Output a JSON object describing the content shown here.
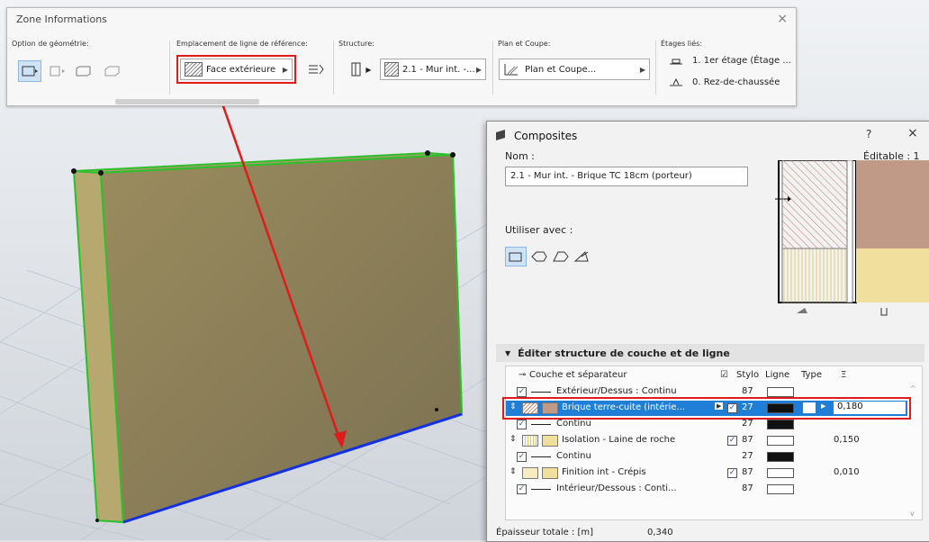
{
  "info": {
    "title": "Zone Informations",
    "groups": {
      "geometry": "Option de géométrie:",
      "refline": "Emplacement de ligne de référence:",
      "structure": "Structure:",
      "plan": "Plan et Coupe:",
      "levels": "Étages liés:"
    },
    "refline_value": "Face extérieure",
    "structure_value": "2.1 - Mur int. -...",
    "plan_value": "Plan et Coupe...",
    "level_top": "1. 1er étage (Étage ...",
    "level_bottom": "0. Rez-de-chaussée"
  },
  "dialog": {
    "title": "Composites",
    "help": "?",
    "close": "×",
    "name_label": "Nom :",
    "editable_label": "Éditable : 1",
    "name_value": "2.1 - Mur int. - Brique TC 18cm (porteur)",
    "use_with_label": "Utiliser avec :",
    "section_title": "Éditer structure de couche et de ligne",
    "columns": {
      "layer": "Couche et séparateur",
      "pen": "Stylo",
      "line": "Ligne",
      "type": "Type"
    },
    "rows": [
      {
        "kind": "sep",
        "label": "Extérieur/Dessus : Continu",
        "pen": "87"
      },
      {
        "kind": "layer",
        "label": "Brique terre-cuite (intérie...",
        "pen": "27",
        "thickness": "0,180",
        "selected": true
      },
      {
        "kind": "sep",
        "label": "Continu",
        "pen": "27"
      },
      {
        "kind": "layer",
        "label": "Isolation - Laine de roche",
        "pen": "87",
        "thickness": "0,150"
      },
      {
        "kind": "sep",
        "label": "Continu",
        "pen": "27"
      },
      {
        "kind": "layer",
        "label": "Finition int - Crépis",
        "pen": "87",
        "thickness": "0,010"
      },
      {
        "kind": "sep",
        "label": "Intérieur/Dessous : Conti...",
        "pen": "87"
      }
    ],
    "total_label": "Épaisseur totale : [m]",
    "total_value": "0,340"
  },
  "colors": {
    "highlight": "#e01b1b",
    "selection": "#1f7fd6",
    "wall": "#8e8158",
    "wall_edges": "#2dc02d",
    "ref_line": "#1530e0",
    "brick": "#c09a86",
    "insulation": "#f1df9e"
  }
}
